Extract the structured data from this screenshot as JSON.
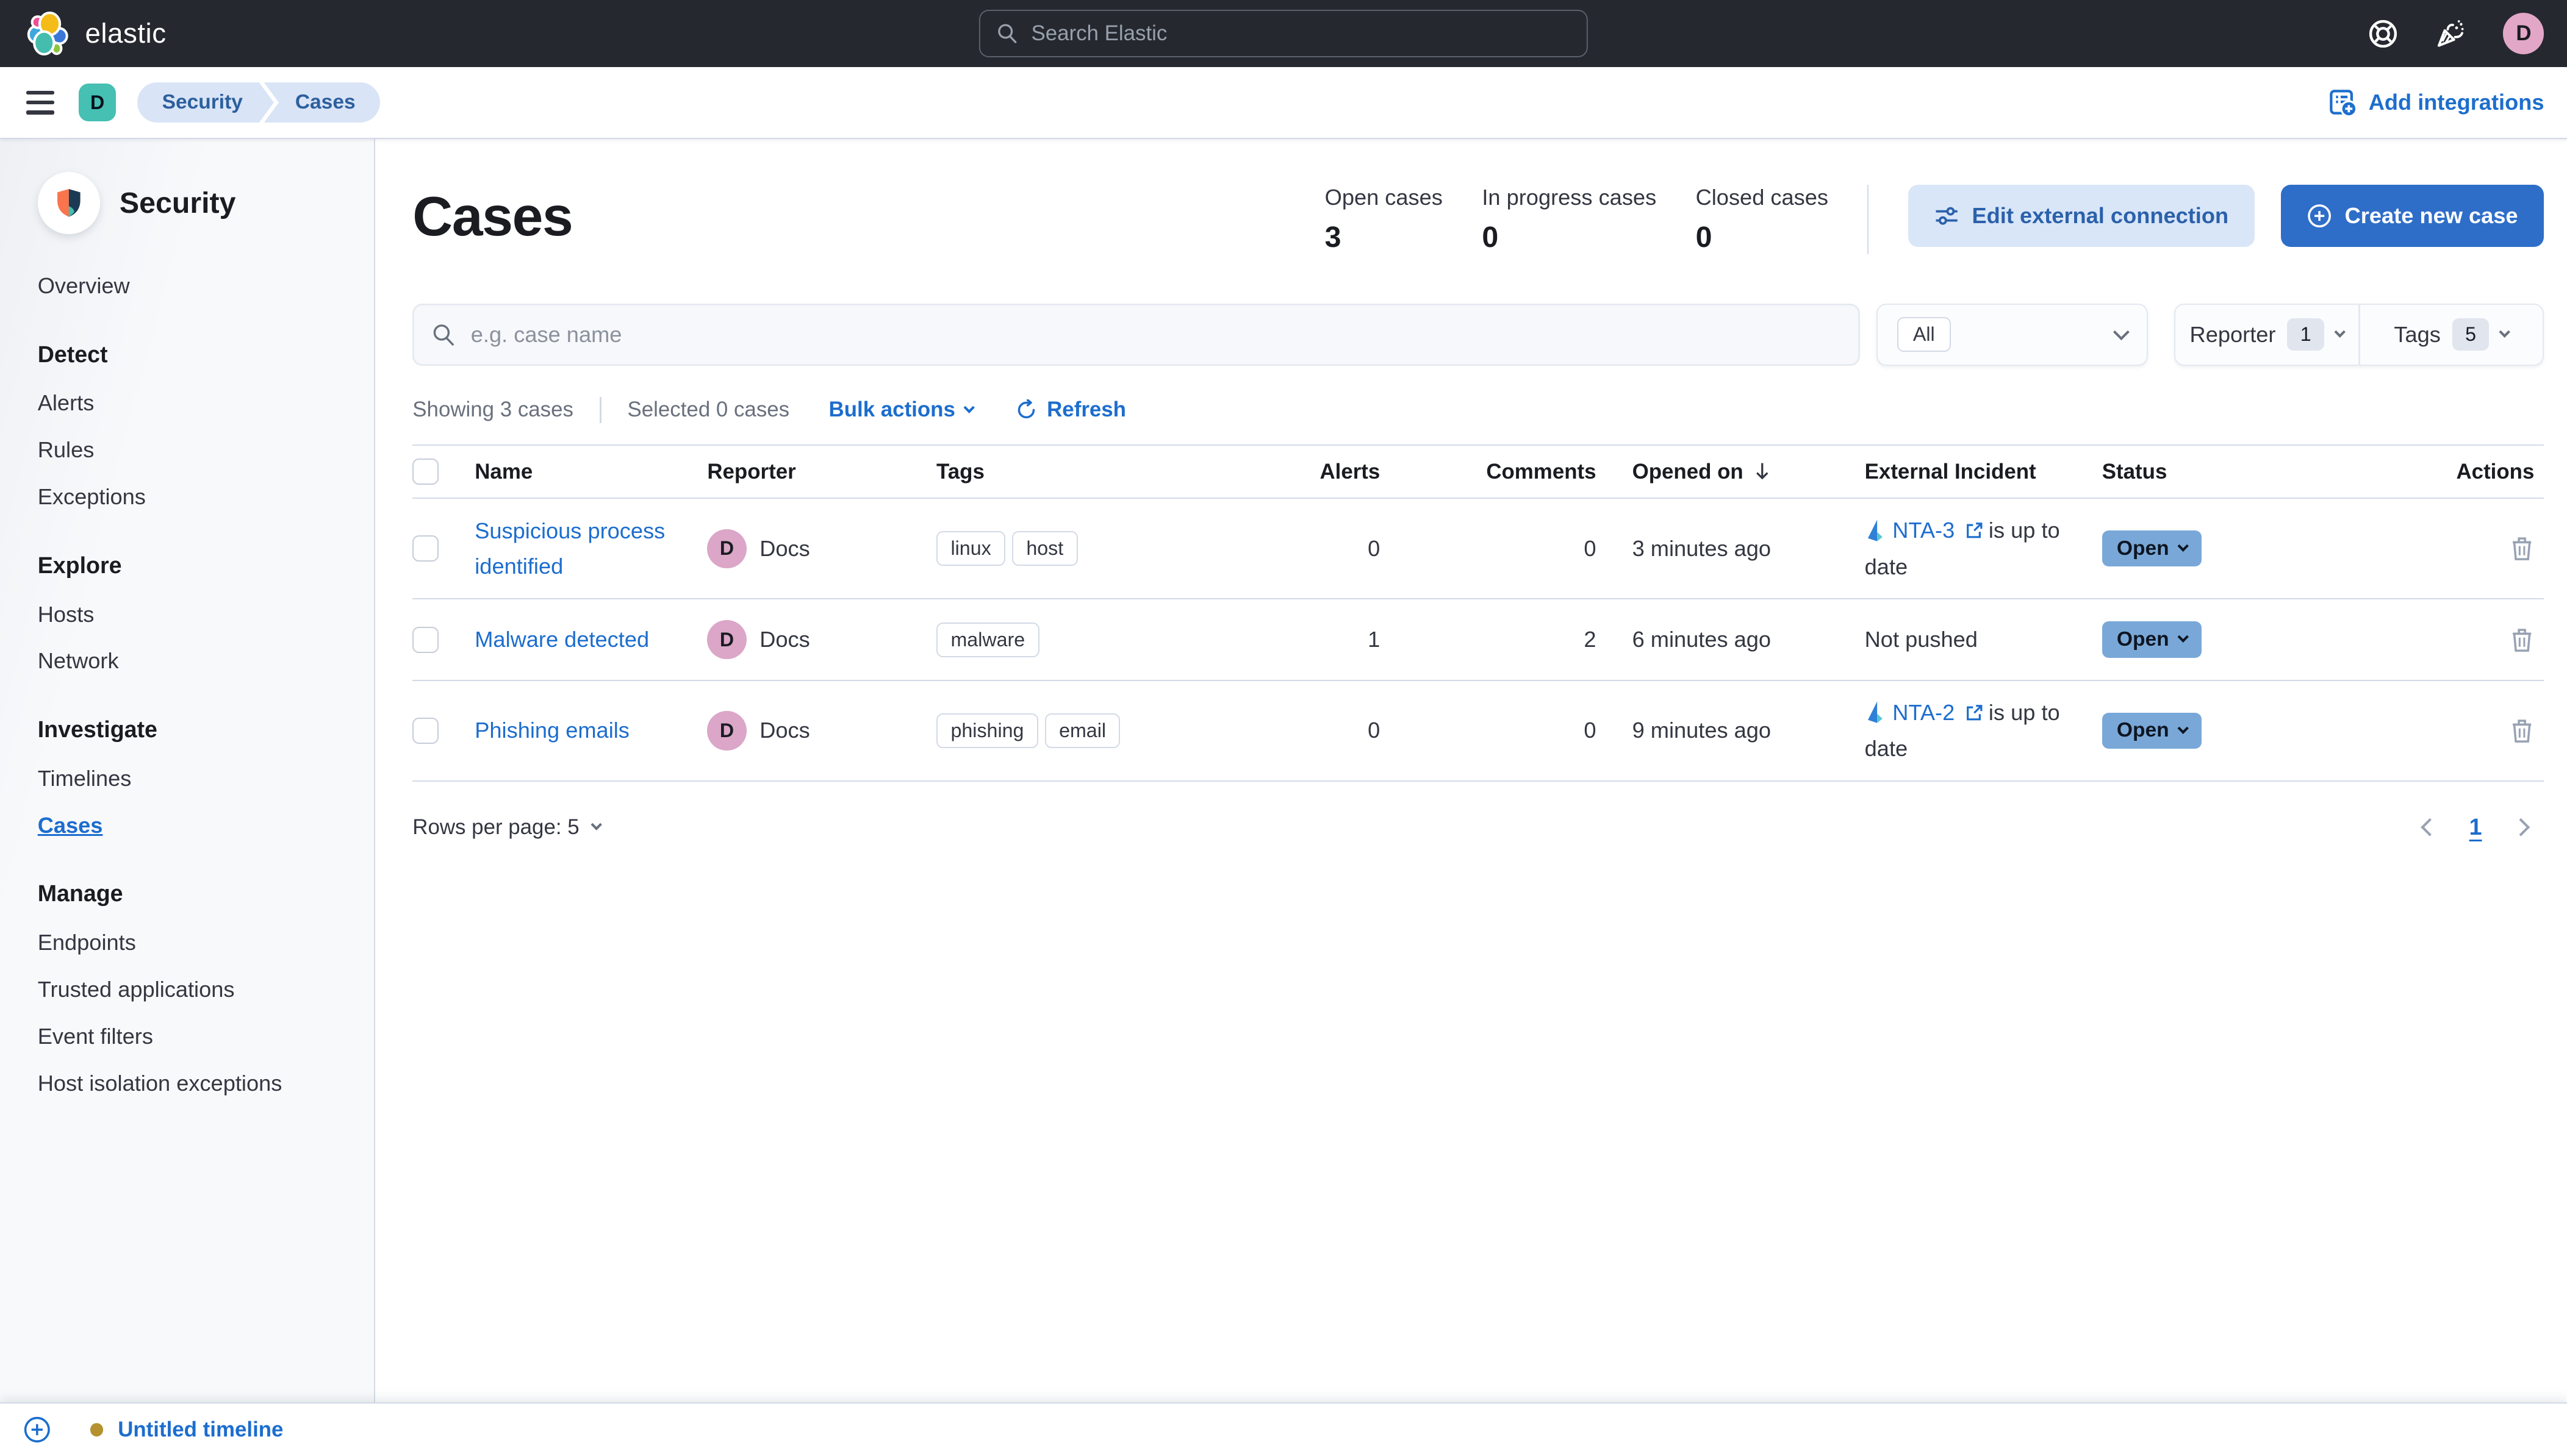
{
  "header": {
    "brand": "elastic",
    "search_placeholder": "Search Elastic",
    "avatar_initial": "D"
  },
  "toolbar": {
    "space_badge": "D",
    "breadcrumbs": [
      "Security",
      "Cases"
    ],
    "add_integrations_label": "Add integrations"
  },
  "sidebar": {
    "title": "Security",
    "sections": [
      {
        "heading": "",
        "items": [
          "Overview"
        ]
      },
      {
        "heading": "Detect",
        "items": [
          "Alerts",
          "Rules",
          "Exceptions"
        ]
      },
      {
        "heading": "Explore",
        "items": [
          "Hosts",
          "Network"
        ]
      },
      {
        "heading": "Investigate",
        "items": [
          "Timelines",
          "Cases"
        ]
      },
      {
        "heading": "Manage",
        "items": [
          "Endpoints",
          "Trusted applications",
          "Event filters",
          "Host isolation exceptions"
        ]
      }
    ],
    "active_item": "Cases"
  },
  "page": {
    "title": "Cases",
    "stats": [
      {
        "label": "Open cases",
        "value": "3"
      },
      {
        "label": "In progress cases",
        "value": "0"
      },
      {
        "label": "Closed cases",
        "value": "0"
      }
    ],
    "edit_external_label": "Edit external connection",
    "create_case_label": "Create new case"
  },
  "filters": {
    "search_placeholder": "e.g. case name",
    "status_selected": "All",
    "reporter_label": "Reporter",
    "reporter_count": "1",
    "tags_label": "Tags",
    "tags_count": "5"
  },
  "util_bar": {
    "showing": "Showing 3 cases",
    "selected": "Selected 0 cases",
    "bulk_actions": "Bulk actions",
    "refresh": "Refresh"
  },
  "table": {
    "columns": [
      "Name",
      "Reporter",
      "Tags",
      "Alerts",
      "Comments",
      "Opened on",
      "External Incident",
      "Status",
      "Actions"
    ],
    "rows": [
      {
        "name": "Suspicious process identified",
        "reporter": "Docs",
        "reporter_initial": "D",
        "tags": [
          "linux",
          "host"
        ],
        "alerts": "0",
        "comments": "0",
        "opened_on": "3 minutes ago",
        "external_incident": "NTA-3",
        "external_suffix": "is up to date",
        "status": "Open"
      },
      {
        "name": "Malware detected",
        "reporter": "Docs",
        "reporter_initial": "D",
        "tags": [
          "malware"
        ],
        "alerts": "1",
        "comments": "2",
        "opened_on": "6 minutes ago",
        "external_text": "Not pushed",
        "status": "Open"
      },
      {
        "name": "Phishing emails",
        "reporter": "Docs",
        "reporter_initial": "D",
        "tags": [
          "phishing",
          "email"
        ],
        "alerts": "0",
        "comments": "0",
        "opened_on": "9 minutes ago",
        "external_incident": "NTA-2",
        "external_suffix": "is up to date",
        "status": "Open"
      }
    ]
  },
  "footer": {
    "rows_per_page": "Rows per page: 5",
    "page": "1"
  },
  "timeline_bar": {
    "label": "Untitled timeline"
  },
  "colors": {
    "primary_blue": "#2e6ec8",
    "link_blue": "#1c6dce",
    "status_badge": "#79a8d8",
    "space_badge_teal": "#45c0b2",
    "avatar_pink": "#dba6c8",
    "timeline_dot_gold": "#b5912f",
    "header_dark": "#25282f"
  }
}
